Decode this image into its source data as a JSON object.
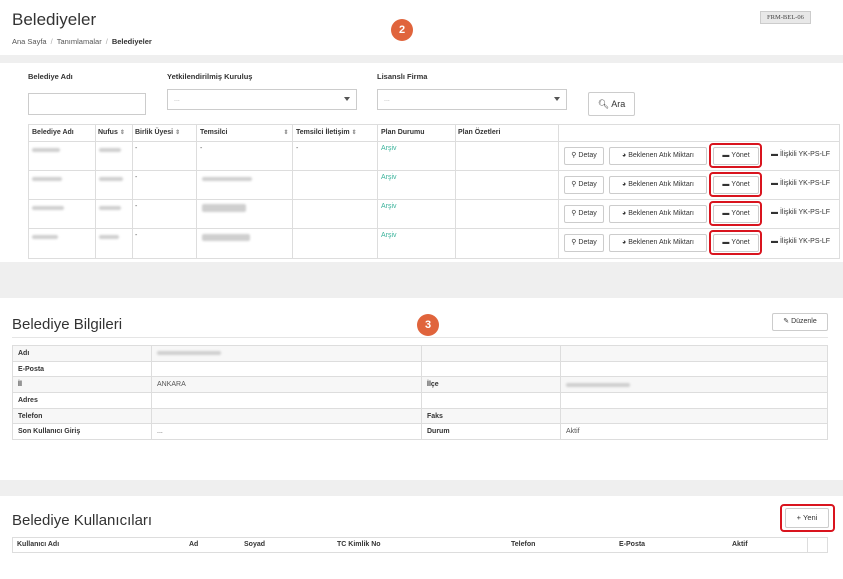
{
  "header": {
    "title": "Belediyeler",
    "breadcrumb": [
      "Ana Sayfa",
      "Tanımlamalar",
      "Belediyeler"
    ],
    "form_code": "FRM-BEL-06"
  },
  "badges": [
    "2",
    "3"
  ],
  "filters": {
    "belediye_label": "Belediye Adı",
    "kurulus_label": "Yetkilendirilmiş Kuruluş",
    "kurulus_value": "...",
    "firma_label": "Lisanslı Firma",
    "firma_value": "...",
    "search_button": "Ara"
  },
  "list": {
    "columns": [
      "Belediye Adı",
      "Nufus",
      "Birlik Üyesi",
      "Temsilci",
      "Temsilci İletişim",
      "Plan Durumu",
      "Plan Özetleri"
    ],
    "rows": [
      {
        "birlik": "-",
        "temsilci": "-",
        "iletisim": "-",
        "plan": "Arşiv"
      },
      {
        "birlik": "-",
        "temsilci": "",
        "iletisim": "",
        "plan": "Arşiv"
      },
      {
        "birlik": "-",
        "temsilci": "",
        "iletisim": "",
        "plan": "Arşiv"
      },
      {
        "birlik": "-",
        "temsilci": "",
        "iletisim": "",
        "plan": "Arşiv"
      }
    ],
    "actions": {
      "detay": "Detay",
      "beklenen": "Beklenen Atık Miktarı",
      "yonet": "Yönet",
      "iliskili": "İlişkili YK-PS-LF"
    }
  },
  "info": {
    "title": "Belediye Bilgileri",
    "edit_button": "Düzenle",
    "rows": [
      {
        "l1": "Adı",
        "v1": "",
        "l2": "",
        "v2": ""
      },
      {
        "l1": "E-Posta",
        "v1": "",
        "l2": "",
        "v2": ""
      },
      {
        "l1": "İl",
        "v1": "ANKARA",
        "l2": "İlçe",
        "v2": ""
      },
      {
        "l1": "Adres",
        "v1": "",
        "l2": "",
        "v2": ""
      },
      {
        "l1": "Telefon",
        "v1": "",
        "l2": "Faks",
        "v2": ""
      },
      {
        "l1": "Son Kullanıcı Giriş",
        "v1": "...",
        "l2": "Durum",
        "v2": "Aktif"
      }
    ]
  },
  "users": {
    "title": "Belediye Kullanıcıları",
    "new_button": "Yeni",
    "columns": [
      "Kullanıcı Adı",
      "Ad",
      "Soyad",
      "TC Kimlik No",
      "Telefon",
      "E-Posta",
      "Aktif"
    ]
  }
}
